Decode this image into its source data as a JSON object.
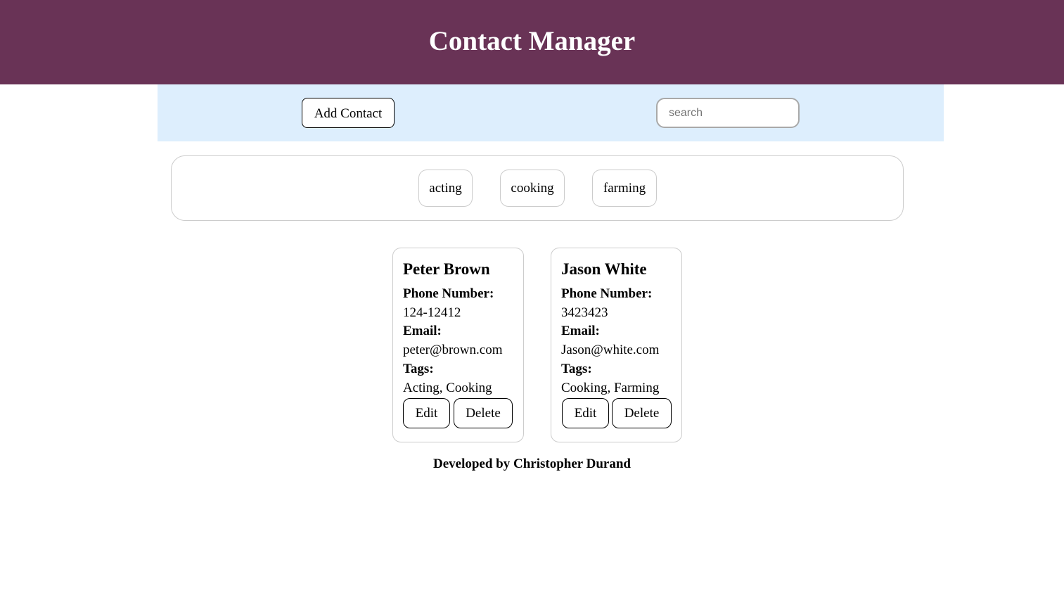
{
  "header": {
    "title": "Contact Manager"
  },
  "toolbar": {
    "add_label": "Add Contact",
    "search_placeholder": "search",
    "search_value": ""
  },
  "tags": [
    "acting",
    "cooking",
    "farming"
  ],
  "labels": {
    "phone": "Phone Number:",
    "email": "Email:",
    "tags": "Tags:",
    "edit": "Edit",
    "delete": "Delete"
  },
  "contacts": [
    {
      "name": "Peter Brown",
      "phone": "124-12412",
      "email": "peter@brown.com",
      "tags": "Acting, Cooking"
    },
    {
      "name": "Jason White",
      "phone": "3423423",
      "email": "Jason@white.com",
      "tags": "Cooking, Farming"
    }
  ],
  "footer": {
    "text": "Developed by Christopher Durand"
  },
  "colors": {
    "header_bg": "#693356",
    "toolbar_bg": "#ddeefd"
  }
}
